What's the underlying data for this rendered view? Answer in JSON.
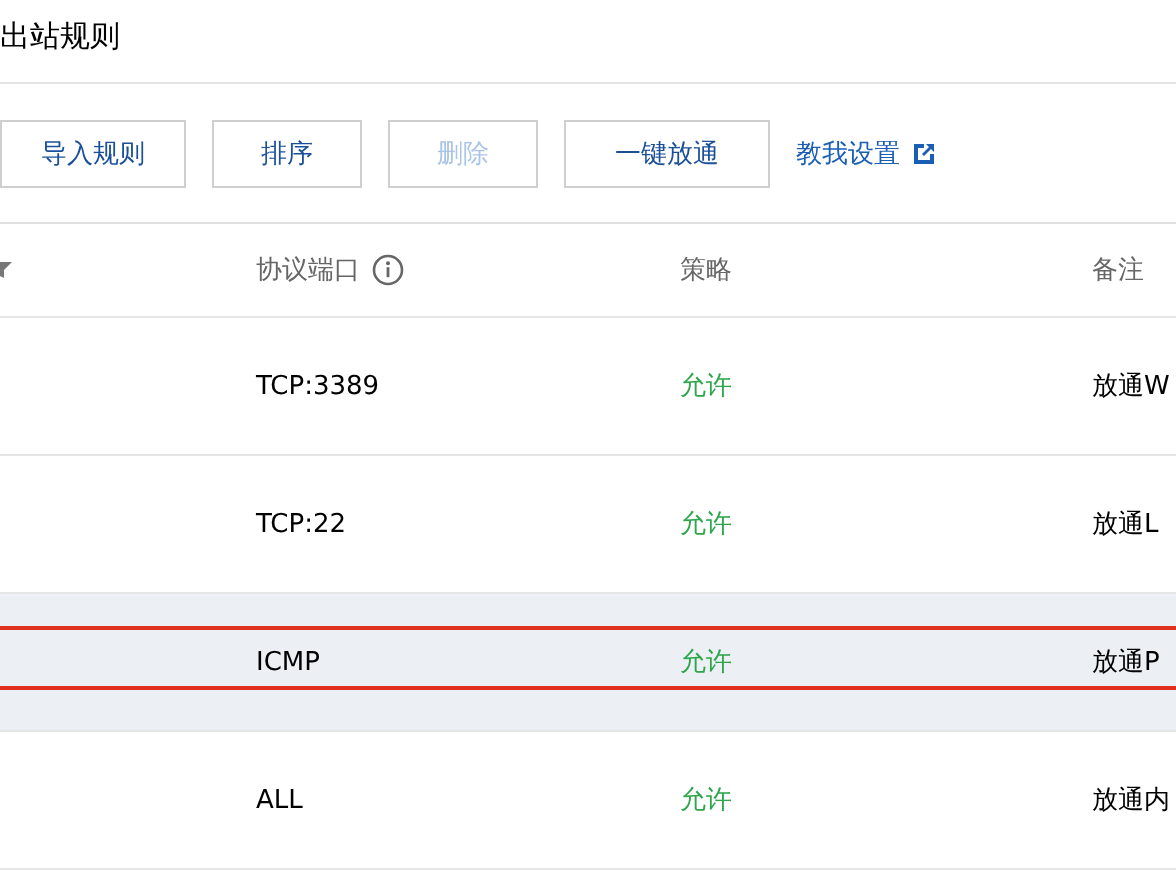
{
  "section": {
    "title": "出站规则"
  },
  "toolbar": {
    "buttons": [
      {
        "label": "导入规则",
        "disabled": false
      },
      {
        "label": "排序",
        "disabled": false
      },
      {
        "label": "删除",
        "disabled": true
      },
      {
        "label": "一键放通",
        "disabled": false
      }
    ],
    "help_link": "教我设置"
  },
  "table": {
    "columns": [
      {
        "kind": "filter"
      },
      {
        "kind": "info",
        "label": "协议端口"
      },
      {
        "kind": "plain",
        "label": "策略"
      },
      {
        "kind": "plain",
        "label": "备注"
      }
    ],
    "rows": [
      {
        "protocol_port": "TCP:3389",
        "policy": "允许",
        "note": "放通W",
        "hovered": false,
        "highlighted": false
      },
      {
        "protocol_port": "TCP:22",
        "policy": "允许",
        "note": "放通L",
        "hovered": false,
        "highlighted": false
      },
      {
        "protocol_port": "ICMP",
        "policy": "允许",
        "note": "放通P",
        "hovered": true,
        "highlighted": true
      },
      {
        "protocol_port": "ALL",
        "policy": "允许",
        "note": "放通内",
        "hovered": false,
        "highlighted": false
      }
    ]
  }
}
